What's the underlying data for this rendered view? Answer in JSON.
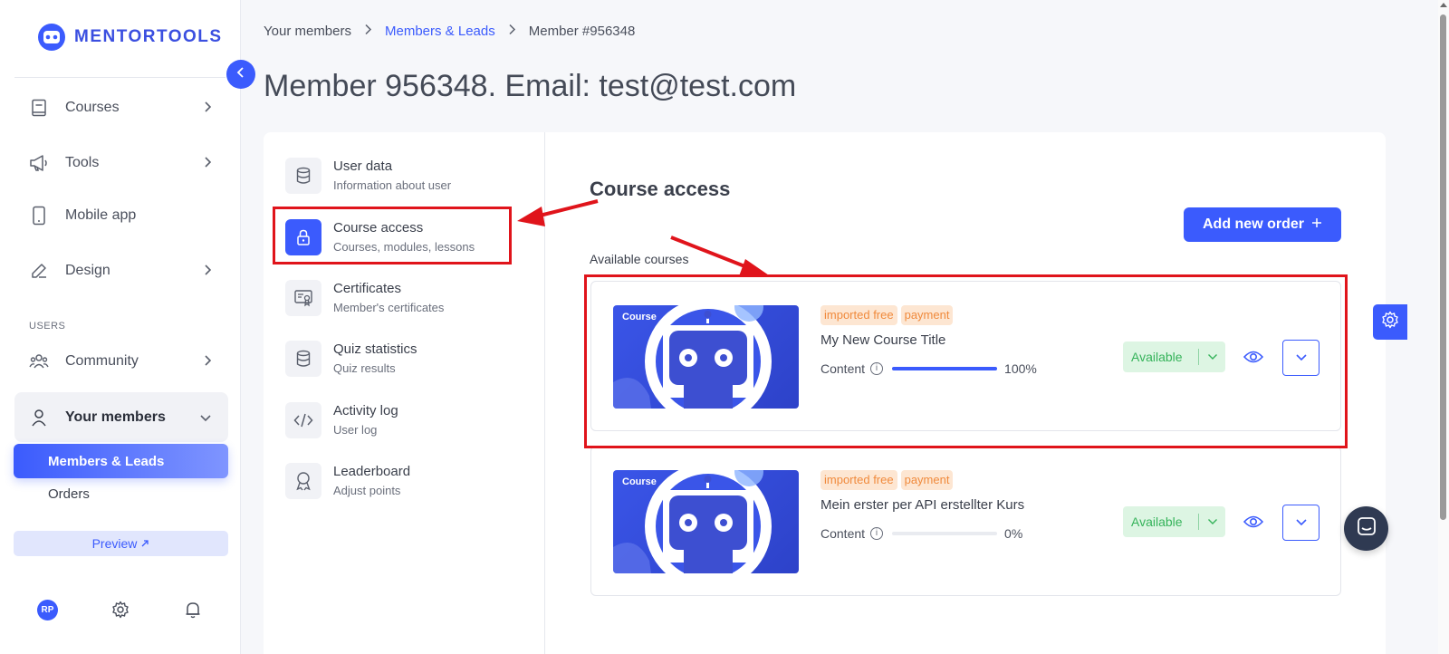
{
  "app": {
    "logo_text": "MENTORTOOLS"
  },
  "sidebar": {
    "items": [
      {
        "label": "Courses",
        "icon": "book-icon",
        "has_chevron": true
      },
      {
        "label": "Tools",
        "icon": "megaphone-icon",
        "has_chevron": true
      },
      {
        "label": "Mobile app",
        "icon": "phone-icon",
        "has_chevron": false
      },
      {
        "label": "Design",
        "icon": "pencil-icon",
        "has_chevron": true
      },
      {
        "label": "Community",
        "icon": "people-icon",
        "has_chevron": true
      },
      {
        "label": "Your members",
        "icon": "user-icon",
        "has_chevron": true
      }
    ],
    "section_users": "USERS",
    "sub_active": "Members & Leads",
    "sub_orders": "Orders",
    "preview_label": "Preview",
    "avatar_initials": "RP"
  },
  "breadcrumb": {
    "items": [
      "Your members",
      "Members & Leads",
      "Member #956348"
    ]
  },
  "page": {
    "title": "Member 956348. Email: test@test.com"
  },
  "member_menu": [
    {
      "title": "User data",
      "subtitle": "Information about user",
      "icon": "database-icon",
      "active": false
    },
    {
      "title": "Course access",
      "subtitle": "Courses, modules, lessons",
      "icon": "lock-icon",
      "active": true
    },
    {
      "title": "Certificates",
      "subtitle": "Member's certificates",
      "icon": "certificate-icon",
      "active": false
    },
    {
      "title": "Quiz statistics",
      "subtitle": "Quiz results",
      "icon": "database-icon",
      "active": false
    },
    {
      "title": "Activity log",
      "subtitle": "User log",
      "icon": "code-icon",
      "active": false
    },
    {
      "title": "Leaderboard",
      "subtitle": "Adjust points",
      "icon": "award-icon",
      "active": false
    }
  ],
  "content": {
    "title": "Course access",
    "add_order_label": "Add new order",
    "available_label": "Available courses",
    "courses": [
      {
        "thumb_tag": "Course",
        "badges": [
          "imported free",
          "payment"
        ],
        "title": "My New Course Title",
        "content_label": "Content",
        "progress": 100,
        "progress_text": "100%",
        "status": "Available"
      },
      {
        "thumb_tag": "Course",
        "badges": [
          "imported free",
          "payment"
        ],
        "title": "Mein erster per API erstellter Kurs",
        "content_label": "Content",
        "progress": 0,
        "progress_text": "0%",
        "status": "Available"
      }
    ]
  },
  "colors": {
    "accent": "#3b5bfd",
    "annotation_red": "#e0141b",
    "status_green": "#35b35a",
    "badge_orange": "#f08a3c"
  }
}
